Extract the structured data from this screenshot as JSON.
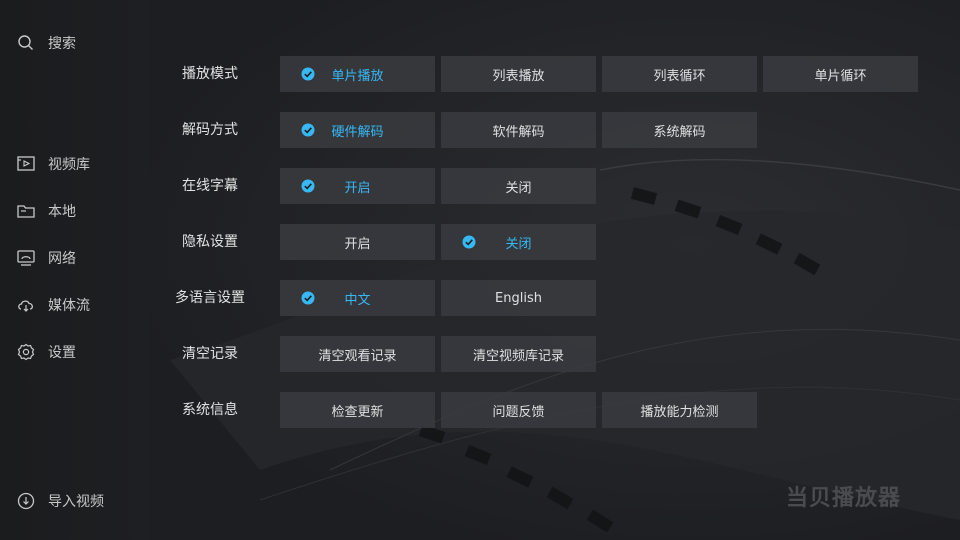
{
  "sidebar": {
    "search_label": "搜索",
    "items": [
      {
        "label": "视频库",
        "icon": "video-library-icon"
      },
      {
        "label": "本地",
        "icon": "folder-icon"
      },
      {
        "label": "网络",
        "icon": "network-icon"
      },
      {
        "label": "媒体流",
        "icon": "cloud-stream-icon"
      },
      {
        "label": "设置",
        "icon": "gear-icon"
      }
    ],
    "import_label": "导入视频"
  },
  "settings": [
    {
      "label": "播放模式",
      "options": [
        {
          "label": "单片播放",
          "selected": true
        },
        {
          "label": "列表播放",
          "selected": false
        },
        {
          "label": "列表循环",
          "selected": false
        },
        {
          "label": "单片循环",
          "selected": false
        }
      ]
    },
    {
      "label": "解码方式",
      "options": [
        {
          "label": "硬件解码",
          "selected": true
        },
        {
          "label": "软件解码",
          "selected": false
        },
        {
          "label": "系统解码",
          "selected": false
        }
      ]
    },
    {
      "label": "在线字幕",
      "options": [
        {
          "label": "开启",
          "selected": true
        },
        {
          "label": "关闭",
          "selected": false
        }
      ]
    },
    {
      "label": "隐私设置",
      "options": [
        {
          "label": "开启",
          "selected": false
        },
        {
          "label": "关闭",
          "selected": true
        }
      ]
    },
    {
      "label": "多语言设置",
      "options": [
        {
          "label": "中文",
          "selected": true
        },
        {
          "label": "English",
          "selected": false
        }
      ]
    },
    {
      "label": "清空记录",
      "options": [
        {
          "label": "清空观看记录",
          "selected": false
        },
        {
          "label": "清空视频库记录",
          "selected": false
        }
      ]
    },
    {
      "label": "系统信息",
      "options": [
        {
          "label": "检查更新",
          "selected": false
        },
        {
          "label": "问题反馈",
          "selected": false
        },
        {
          "label": "播放能力检测",
          "selected": false
        }
      ]
    }
  ],
  "brand": "当贝播放器",
  "colors": {
    "accent": "#36b8f5",
    "background": "#1d1e21",
    "button": "#3a3b3f"
  }
}
